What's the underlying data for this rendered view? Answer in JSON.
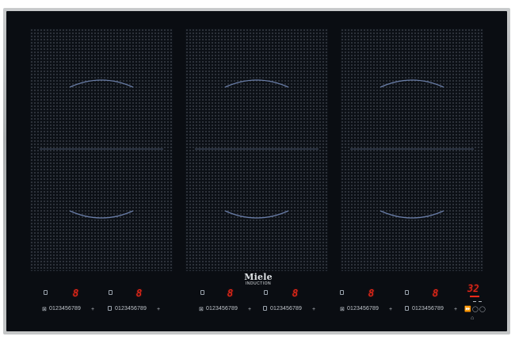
{
  "brand": {
    "name": "Miele",
    "subtitle": "INDUCTION"
  },
  "zones": [
    {
      "id": "left"
    },
    {
      "id": "middle"
    },
    {
      "id": "right"
    }
  ],
  "controls": {
    "power_digit": "8",
    "scale_label": "0123456789",
    "plus_symbol": "+",
    "timer_display": "32",
    "icons": [
      "zone-icon",
      "timer-icon",
      "stop-and-go-icon",
      "lock-icon"
    ]
  },
  "colors": {
    "glass": "#0a0d12",
    "frame": "#b5b8ba",
    "display_red": "#ff2a1a",
    "mark_blue": "#5a6f9a"
  }
}
